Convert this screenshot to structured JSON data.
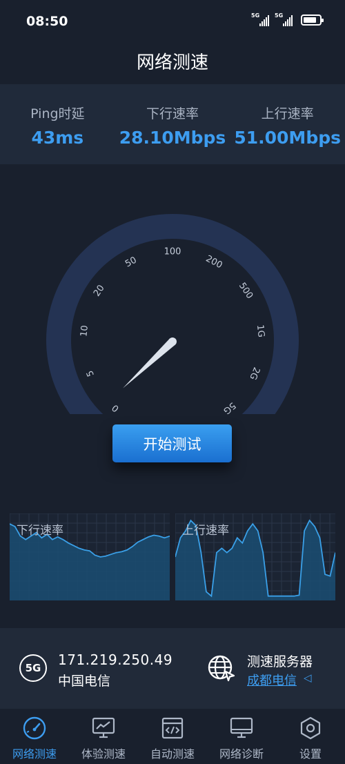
{
  "status_bar": {
    "time": "08:50",
    "sim1_label": "5G",
    "sim2_label": "5G",
    "battery": "full"
  },
  "header": {
    "title": "网络测速"
  },
  "stats": {
    "ping_label": "Ping时延",
    "ping_value": "43ms",
    "download_label": "下行速率",
    "download_value": "28.10Mbps",
    "upload_label": "上行速率",
    "upload_value": "51.00Mbps"
  },
  "gauge": {
    "ticks": [
      "0",
      "5",
      "10",
      "20",
      "50",
      "100",
      "200",
      "500",
      "1G",
      "2G",
      "5G"
    ],
    "needle_reading": "0",
    "colors": {
      "arc": "#243353",
      "needle": "#dde3ec"
    }
  },
  "actions": {
    "start_label": "开始测试"
  },
  "charts": {
    "download": {
      "label": "下行速率",
      "values": [
        0.88,
        0.85,
        0.74,
        0.7,
        0.74,
        0.78,
        0.72,
        0.76,
        0.7,
        0.73,
        0.7,
        0.66,
        0.63,
        0.6,
        0.58,
        0.57,
        0.52,
        0.5,
        0.51,
        0.53,
        0.55,
        0.56,
        0.58,
        0.62,
        0.67,
        0.7,
        0.73,
        0.75,
        0.74,
        0.72,
        0.74
      ]
    },
    "upload": {
      "label": "上行速率",
      "values": [
        0.5,
        0.72,
        0.8,
        0.92,
        0.86,
        0.55,
        0.1,
        0.05,
        0.55,
        0.6,
        0.55,
        0.6,
        0.72,
        0.66,
        0.8,
        0.88,
        0.8,
        0.55,
        0.05,
        0.05,
        0.05,
        0.05,
        0.05,
        0.05,
        0.06,
        0.8,
        0.92,
        0.85,
        0.72,
        0.3,
        0.28,
        0.55
      ]
    },
    "colors": {
      "line": "#3aa0e8",
      "fill": "#1a4d73",
      "grid": "#2b3648",
      "bg": "#1b2433"
    }
  },
  "network": {
    "type_badge": "5G",
    "ip": "171.219.250.49",
    "carrier": "中国电信",
    "server_title": "测速服务器",
    "server_name": "成都电信",
    "server_caret": "◁"
  },
  "tabs": [
    {
      "label": "网络测速",
      "icon": "speedometer-icon",
      "active": true
    },
    {
      "label": "体验测速",
      "icon": "monitor-chart-icon",
      "active": false
    },
    {
      "label": "自动测速",
      "icon": "code-window-icon",
      "active": false
    },
    {
      "label": "网络诊断",
      "icon": "desktop-icon",
      "active": false
    },
    {
      "label": "设置",
      "icon": "hexagon-gear-icon",
      "active": false
    }
  ],
  "accent_color": "#3d9df0"
}
